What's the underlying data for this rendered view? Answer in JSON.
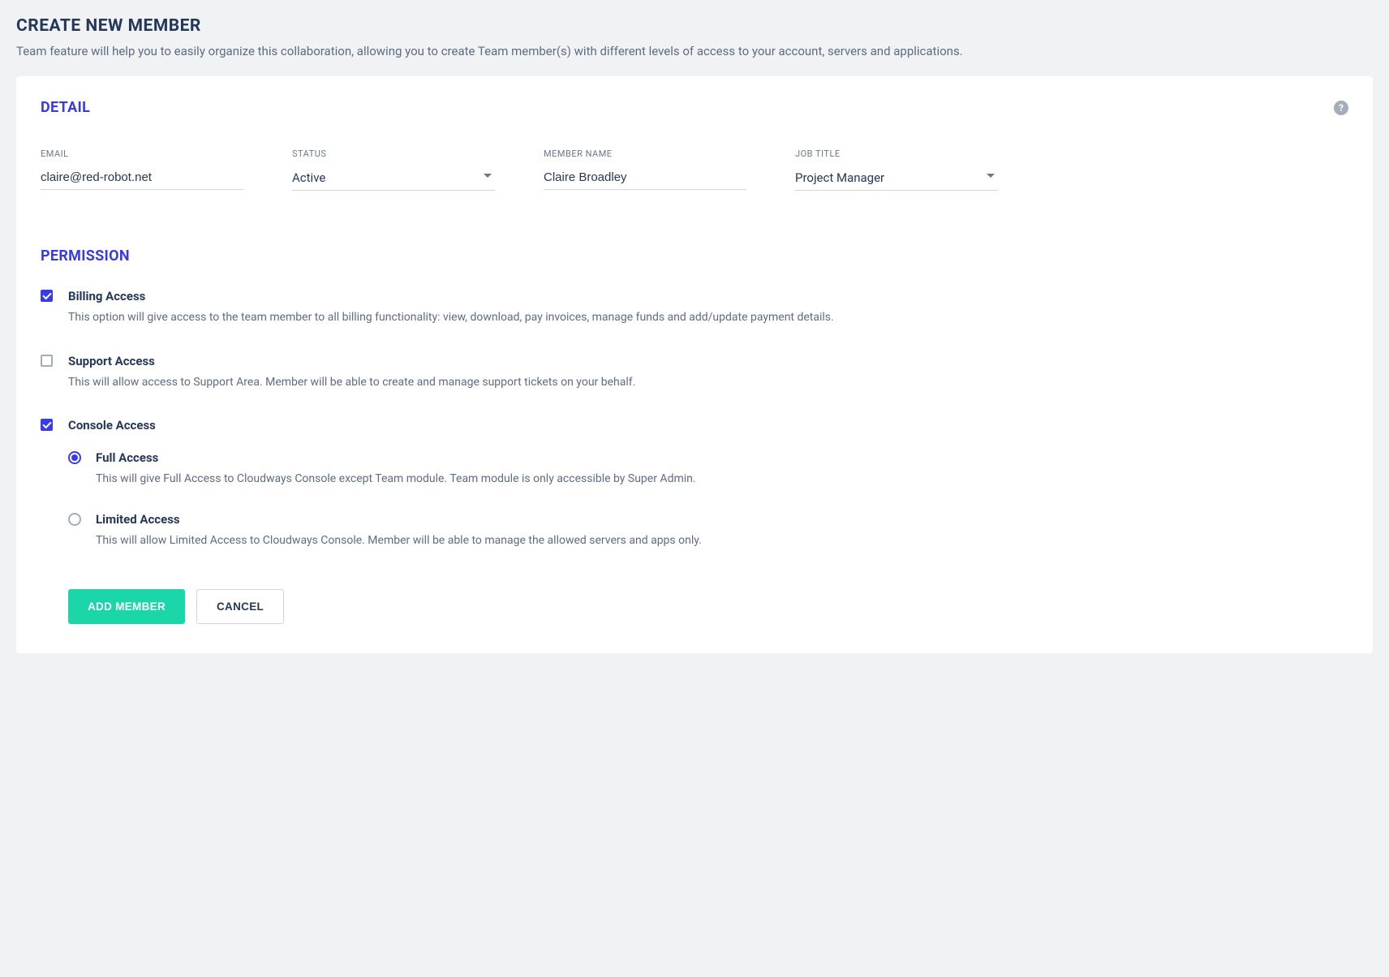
{
  "page": {
    "title": "CREATE NEW MEMBER",
    "subtitle": "Team feature will help you to easily organize this collaboration, allowing you to create Team member(s) with different levels of access to your account, servers and applications."
  },
  "detail": {
    "heading": "DETAIL",
    "help_symbol": "?",
    "fields": {
      "email": {
        "label": "EMAIL",
        "value": "claire@red-robot.net"
      },
      "status": {
        "label": "STATUS",
        "value": "Active"
      },
      "member_name": {
        "label": "MEMBER NAME",
        "value": "Claire Broadley"
      },
      "job_title": {
        "label": "JOB TITLE",
        "value": "Project Manager"
      }
    }
  },
  "permission": {
    "heading": "PERMISSION",
    "items": [
      {
        "key": "billing",
        "checked": true,
        "title": "Billing Access",
        "desc": "This option will give access to the team member to all billing functionality: view, download, pay invoices, manage funds and add/update payment details."
      },
      {
        "key": "support",
        "checked": false,
        "title": "Support Access",
        "desc": "This will allow access to Support Area. Member will be able to create and manage support tickets on your behalf."
      },
      {
        "key": "console",
        "checked": true,
        "title": "Console Access",
        "desc": "",
        "sub": [
          {
            "key": "full",
            "selected": true,
            "title": "Full Access",
            "desc": "This will give Full Access to Cloudways Console except Team module. Team module is only accessible by Super Admin."
          },
          {
            "key": "limited",
            "selected": false,
            "title": "Limited Access",
            "desc": "This will allow Limited Access to Cloudways Console. Member will be able to manage the allowed servers and apps only."
          }
        ]
      }
    ]
  },
  "actions": {
    "add_member": "ADD MEMBER",
    "cancel": "CANCEL"
  }
}
